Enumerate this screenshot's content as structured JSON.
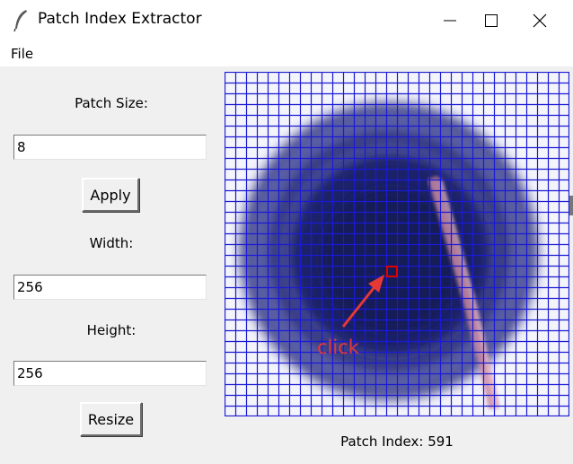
{
  "window": {
    "title": "Patch Index Extractor",
    "controls": [
      "minimize",
      "maximize",
      "close"
    ]
  },
  "menu": {
    "file_label": "File"
  },
  "form": {
    "patch_size_label": "Patch Size:",
    "patch_size_value": "8",
    "apply_label": "Apply",
    "width_label": "Width:",
    "width_value": "256",
    "height_label": "Height:",
    "height_value": "256",
    "resize_label": "Resize"
  },
  "canvas": {
    "grid_color": "#1a1ad4",
    "selection_color": "#e00000",
    "patch_grid": {
      "cols": 32,
      "rows": 32
    },
    "selected_patch": 591,
    "image": "dark circular lens/bowl photo"
  },
  "status": {
    "text": "Patch Index: 591"
  },
  "annotation": {
    "text": "click",
    "color": "#e53935"
  }
}
